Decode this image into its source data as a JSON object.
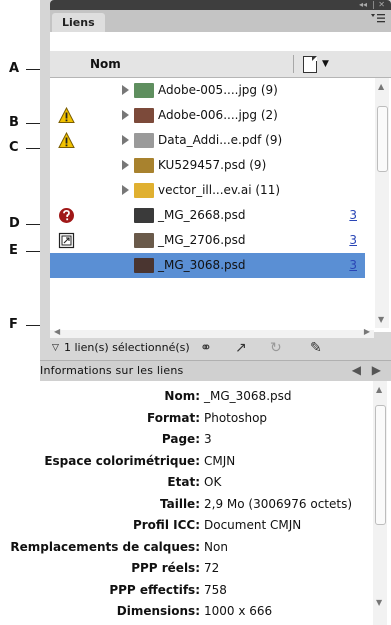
{
  "callouts": [
    "A",
    "B",
    "C",
    "D",
    "E",
    "F"
  ],
  "panel": {
    "tab_label": "Liens",
    "menu_icon": "panel-menu-icon",
    "header_controls": [
      "◂◂",
      "|",
      "✕"
    ]
  },
  "links_table": {
    "column_name": "Nom",
    "column_page_icon": "page-icon",
    "rows": [
      {
        "name": "Adobe-005....jpg (9)",
        "status": "",
        "expandable": true,
        "page": "",
        "thumb_color": "#5f8f5f"
      },
      {
        "name": "Adobe-006....jpg (2)",
        "status": "modified-warning",
        "expandable": true,
        "page": "",
        "thumb_color": "#7c4a3a"
      },
      {
        "name": "Data_Addi...e.pdf (9)",
        "status": "warning",
        "expandable": true,
        "page": "",
        "thumb_color": "#9a9a9a"
      },
      {
        "name": "KU529457.psd (9)",
        "status": "",
        "expandable": true,
        "page": "",
        "thumb_color": "#a8822e"
      },
      {
        "name": "vector_ill...ev.ai (11)",
        "status": "",
        "expandable": true,
        "page": "",
        "thumb_color": "#e0b030"
      },
      {
        "name": "_MG_2668.psd",
        "status": "missing",
        "expandable": false,
        "page": "3",
        "thumb_color": "#3a3a3a"
      },
      {
        "name": "_MG_2706.psd",
        "status": "embedded",
        "expandable": false,
        "page": "3",
        "thumb_color": "#6a5a4a"
      },
      {
        "name": "_MG_3068.psd",
        "status": "",
        "expandable": false,
        "page": "3",
        "thumb_color": "#4a3530",
        "selected": true
      }
    ]
  },
  "status_bar": {
    "selected_text": "1 lien(s) sélectionné(s)"
  },
  "info": {
    "title": "Informations sur les liens",
    "fields": [
      {
        "label": "Nom:",
        "value": "_MG_3068.psd"
      },
      {
        "label": "Format:",
        "value": "Photoshop"
      },
      {
        "label": "Page:",
        "value": "3"
      },
      {
        "label": "Espace colorimétrique:",
        "value": "CMJN"
      },
      {
        "label": "Etat:",
        "value": "OK"
      },
      {
        "label": "Taille:",
        "value": "2,9 Mo (3006976 octets)"
      },
      {
        "label": "Profil ICC:",
        "value": "Document CMJN"
      },
      {
        "label": "Remplacements de calques:",
        "value": "Non"
      },
      {
        "label": "PPP réels:",
        "value": "72"
      },
      {
        "label": "PPP effectifs:",
        "value": "758"
      },
      {
        "label": "Dimensions:",
        "value": "1000 x 666"
      }
    ]
  },
  "colors": {
    "selection": "#5a8fd4",
    "page_link": "#2a46b6",
    "warning_yellow": "#f2c200",
    "missing_red": "#a01818"
  }
}
